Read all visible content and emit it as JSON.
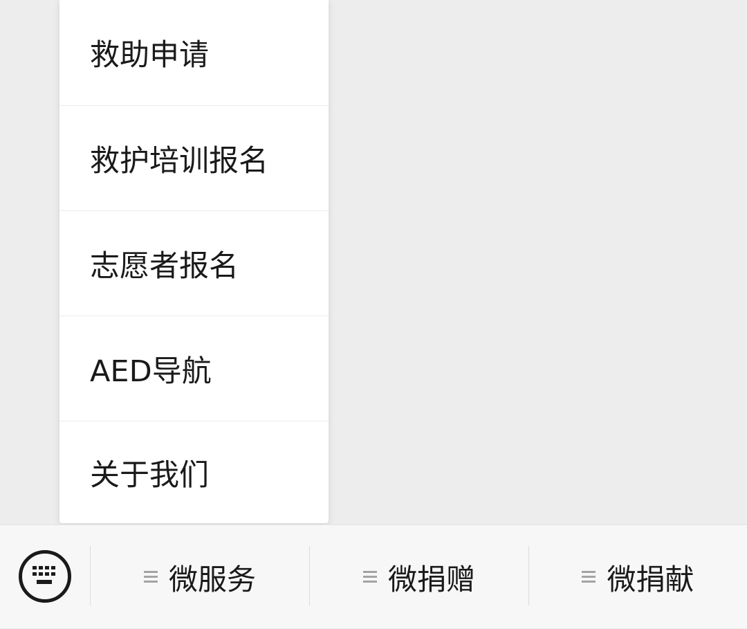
{
  "popup_menu": {
    "items": [
      {
        "label": "救助申请"
      },
      {
        "label": "救护培训报名"
      },
      {
        "label": "志愿者报名"
      },
      {
        "label": "AED导航"
      },
      {
        "label": "关于我们"
      }
    ]
  },
  "bottom_bar": {
    "keyboard_icon": "keyboard-icon",
    "tab_icon": "menu-lines-icon",
    "tabs": [
      {
        "label": "微服务"
      },
      {
        "label": "微捐赠"
      },
      {
        "label": "微捐献"
      }
    ]
  },
  "colors": {
    "background": "#ededed",
    "menu_background": "#ffffff",
    "bar_background": "#f7f7f7",
    "text": "#1a1a1a",
    "icon_gray": "#a3a3a3"
  }
}
